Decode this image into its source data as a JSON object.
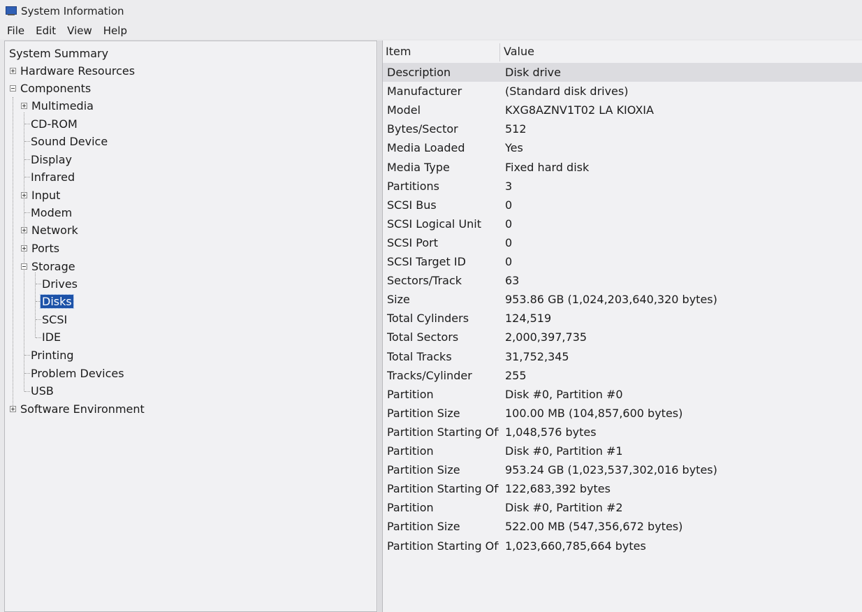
{
  "window": {
    "title": "System Information"
  },
  "menu": [
    "File",
    "Edit",
    "View",
    "Help"
  ],
  "tree": {
    "system_summary": "System Summary",
    "hardware_resources": "Hardware Resources",
    "components": "Components",
    "multimedia": "Multimedia",
    "cd_rom": "CD-ROM",
    "sound_device": "Sound Device",
    "display": "Display",
    "infrared": "Infrared",
    "input": "Input",
    "modem": "Modem",
    "network": "Network",
    "ports": "Ports",
    "storage": "Storage",
    "drives": "Drives",
    "disks": "Disks",
    "scsi": "SCSI",
    "ide": "IDE",
    "printing": "Printing",
    "problem_devices": "Problem Devices",
    "usb": "USB",
    "software_environment": "Software Environment"
  },
  "list": {
    "columns": {
      "item": "Item",
      "value": "Value"
    },
    "rows": [
      {
        "item": "Description",
        "value": "Disk drive"
      },
      {
        "item": "Manufacturer",
        "value": "(Standard disk drives)"
      },
      {
        "item": "Model",
        "value": "KXG8AZNV1T02 LA KIOXIA"
      },
      {
        "item": "Bytes/Sector",
        "value": "512"
      },
      {
        "item": "Media Loaded",
        "value": "Yes"
      },
      {
        "item": "Media Type",
        "value": "Fixed hard disk"
      },
      {
        "item": "Partitions",
        "value": "3"
      },
      {
        "item": "SCSI Bus",
        "value": "0"
      },
      {
        "item": "SCSI Logical Unit",
        "value": "0"
      },
      {
        "item": "SCSI Port",
        "value": "0"
      },
      {
        "item": "SCSI Target ID",
        "value": "0"
      },
      {
        "item": "Sectors/Track",
        "value": "63"
      },
      {
        "item": "Size",
        "value": "953.86 GB (1,024,203,640,320 bytes)"
      },
      {
        "item": "Total Cylinders",
        "value": "124,519"
      },
      {
        "item": "Total Sectors",
        "value": "2,000,397,735"
      },
      {
        "item": "Total Tracks",
        "value": "31,752,345"
      },
      {
        "item": "Tracks/Cylinder",
        "value": "255"
      },
      {
        "item": "Partition",
        "value": "Disk #0, Partition #0"
      },
      {
        "item": "Partition Size",
        "value": "100.00 MB (104,857,600 bytes)"
      },
      {
        "item": "Partition Starting Off...",
        "value": "1,048,576 bytes"
      },
      {
        "item": "Partition",
        "value": "Disk #0, Partition #1"
      },
      {
        "item": "Partition Size",
        "value": "953.24 GB (1,023,537,302,016 bytes)"
      },
      {
        "item": "Partition Starting Off...",
        "value": "122,683,392 bytes"
      },
      {
        "item": "Partition",
        "value": "Disk #0, Partition #2"
      },
      {
        "item": "Partition Size",
        "value": "522.00 MB (547,356,672 bytes)"
      },
      {
        "item": "Partition Starting Off...",
        "value": "1,023,660,785,664 bytes"
      }
    ]
  }
}
